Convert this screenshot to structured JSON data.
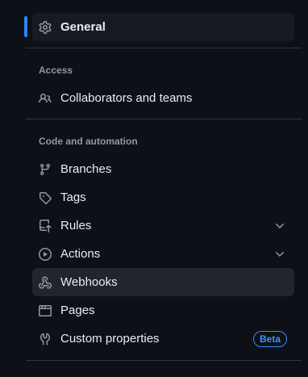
{
  "nav": {
    "general": {
      "label": "General",
      "icon": "gear-icon"
    },
    "access": {
      "title": "Access",
      "items": [
        {
          "label": "Collaborators and teams",
          "icon": "people-icon"
        }
      ]
    },
    "code_automation": {
      "title": "Code and automation",
      "items": [
        {
          "label": "Branches",
          "icon": "git-branch-icon"
        },
        {
          "label": "Tags",
          "icon": "tag-icon"
        },
        {
          "label": "Rules",
          "icon": "repo-push-icon",
          "expandable": true
        },
        {
          "label": "Actions",
          "icon": "play-icon",
          "expandable": true
        },
        {
          "label": "Webhooks",
          "icon": "webhook-icon"
        },
        {
          "label": "Pages",
          "icon": "browser-icon"
        },
        {
          "label": "Custom properties",
          "icon": "note-icon",
          "badge": "Beta"
        }
      ]
    }
  },
  "colors": {
    "background": "#0d1117",
    "active_bg": "#161b22",
    "hover_bg": "#21262d",
    "accent": "#2f81f7",
    "badge": "#4493f8",
    "muted": "#9198a1",
    "text": "#e6edf3",
    "border": "#30363d"
  }
}
